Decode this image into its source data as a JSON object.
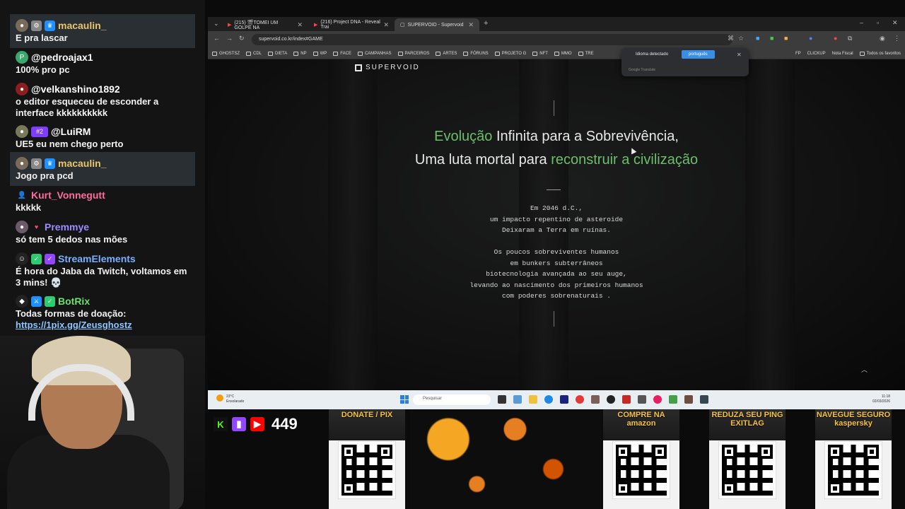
{
  "chat": {
    "messages": [
      {
        "user": "macaulin_",
        "text": "E pra lascar",
        "highlight": true,
        "user_color": "#e9c46a"
      },
      {
        "user": "@pedroajax1",
        "text": "100% pro pc",
        "highlight": false,
        "user_color": "#ffffff",
        "avatar_letter": "P"
      },
      {
        "user": "@velkanshino1892",
        "text": "o editor esqueceu de esconder a interface kkkkkkkkkk",
        "highlight": false,
        "user_color": "#ffffff"
      },
      {
        "user": "@LuiRM",
        "text": "UE5 eu nem chego perto",
        "highlight": false,
        "user_color": "#ffffff",
        "badge_text": "#2"
      },
      {
        "user": "macaulin_",
        "text": "Jogo pra pcd",
        "highlight": true,
        "user_color": "#e9c46a"
      },
      {
        "user": "Kurt_Vonnegutt",
        "text": "kkkkk",
        "highlight": false,
        "user_color": "#ff6b9d"
      },
      {
        "user": "Premmye",
        "text": "só tem 5 dedos nas mões",
        "highlight": false,
        "user_color": "#9b8cff"
      },
      {
        "user": "StreamElements",
        "text": "É hora do Jaba da Twitch, voltamos em 3 mins! 💀",
        "highlight": false,
        "user_color": "#7ab0ff"
      },
      {
        "user": "BotRix",
        "text": "Todas formas de doação:",
        "link": "https://1pix.gg/Zeusghostz",
        "highlight": false,
        "user_color": "#6ee06e"
      }
    ]
  },
  "browser": {
    "tabs": [
      {
        "label": "(215) 🎬TOMEI UM GOLPE NA",
        "active": false
      },
      {
        "label": "(216) Project DNA - Reveal Trai",
        "active": false
      },
      {
        "label": "SUPERVOID - Supervoid",
        "active": true
      }
    ],
    "url": "supervoid.co.kr/index#GAME",
    "bookmarks": [
      "GHOSTSZ",
      "CDL",
      "DIETA",
      "NP",
      "WP",
      "FACE",
      "CAMPANHAS",
      "PARCEIROS",
      "ARTES",
      "FÓRUNS",
      "PROJETO G",
      "NFT",
      "MMO",
      "TRE"
    ],
    "bookmarks_right": [
      "FP",
      "CLICKUP",
      "Nota Fiscal",
      "Todos os favoritos"
    ],
    "translate": {
      "detected": "Idioma detectado",
      "target": "português",
      "footer": "Google Translate"
    }
  },
  "site": {
    "logo": "SUPERVOID",
    "headline1": {
      "a": "Evolução",
      "b": " Infinita",
      "c": " para a Sobrevivência,"
    },
    "headline2": {
      "a": "Uma luta mortal para ",
      "b": "reconstruir a civilização"
    },
    "story1": [
      "Em 2046 d.C.,",
      "um impacto repentino de asteroide",
      "Deixaram a Terra em ruínas."
    ],
    "story2": [
      "Os poucos sobreviventes humanos",
      "em bunkers subterrâneos",
      "biotecnologia avançada ao seu auge,",
      "levando ao nascimento dos primeiros humanos",
      "com poderes sobrenaturais ."
    ]
  },
  "taskbar": {
    "weather_temp": "23°C",
    "weather_desc": "Ensolarado",
    "search_placeholder": "Pesquisar",
    "time": "11:18",
    "date": "02/03/2026"
  },
  "overlay": {
    "viewers": "449",
    "panels": [
      {
        "title": "DONATE / PIX"
      },
      {
        "title": "COMPRE NA amazon"
      },
      {
        "title": "REDUZA SEU PING EXITLAG"
      },
      {
        "title": "NAVEGUE SEGURO kaspersky"
      }
    ]
  },
  "colors": {
    "accent_green": "#6abf69",
    "highlight_bg": "#2a2f33",
    "taskbar_bg": "#e9eef3"
  }
}
